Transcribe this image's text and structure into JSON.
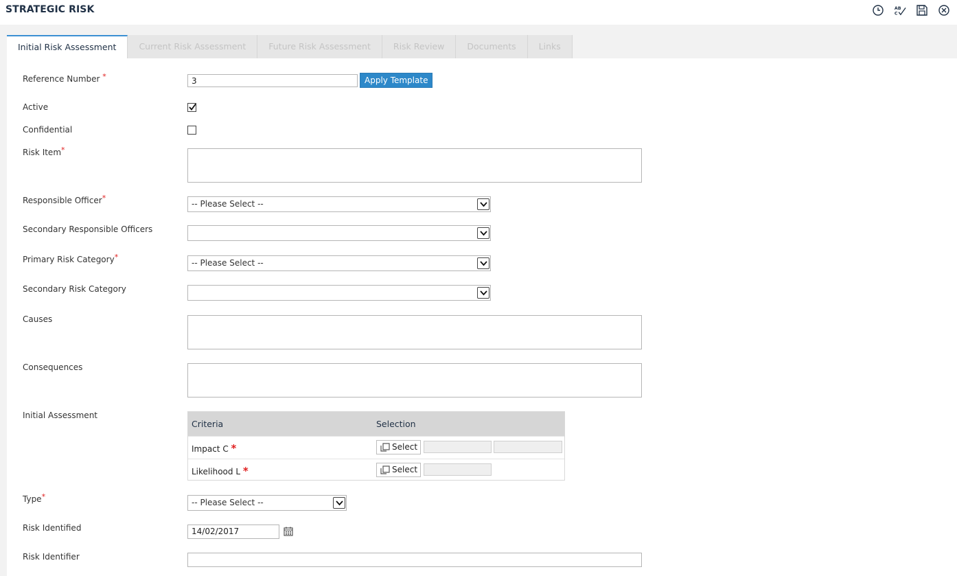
{
  "header": {
    "title": "STRATEGIC RISK",
    "toolbar": [
      {
        "name": "history-icon"
      },
      {
        "name": "spellcheck-icon"
      },
      {
        "name": "save-icon"
      },
      {
        "name": "close-icon"
      }
    ]
  },
  "tabs": [
    {
      "label": "Initial Risk Assessment",
      "active": true
    },
    {
      "label": "Current Risk Assessment",
      "active": false
    },
    {
      "label": "Future Risk Assessment",
      "active": false
    },
    {
      "label": "Risk Review",
      "active": false
    },
    {
      "label": "Documents",
      "active": false
    },
    {
      "label": "Links",
      "active": false
    }
  ],
  "form": {
    "required_marker": "*",
    "reference_number": {
      "label": "Reference Number",
      "value": "3",
      "apply_template_label": "Apply Template"
    },
    "active": {
      "label": "Active",
      "checked": true
    },
    "confidential": {
      "label": "Confidential",
      "checked": false
    },
    "risk_item": {
      "label": "Risk Item",
      "value": ""
    },
    "responsible_officer": {
      "label": "Responsible Officer",
      "value": "-- Please Select --"
    },
    "secondary_responsible_officers": {
      "label": "Secondary Responsible Officers",
      "value": ""
    },
    "primary_risk_category": {
      "label": "Primary Risk Category",
      "value": "-- Please Select --"
    },
    "secondary_risk_category": {
      "label": "Secondary Risk Category",
      "value": ""
    },
    "causes": {
      "label": "Causes",
      "value": ""
    },
    "consequences": {
      "label": "Consequences",
      "value": ""
    },
    "initial_assessment": {
      "label": "Initial Assessment",
      "columns": [
        "Criteria",
        "Selection"
      ],
      "rows": [
        {
          "criteria": "Impact C",
          "button": "Select"
        },
        {
          "criteria": "Likelihood L",
          "button": "Select"
        }
      ]
    },
    "type": {
      "label": "Type",
      "value": "-- Please Select --"
    },
    "risk_identified": {
      "label": "Risk Identified",
      "value": "14/02/2017"
    },
    "risk_identifier": {
      "label": "Risk Identifier",
      "value": ""
    }
  },
  "colors": {
    "accent": "#2d88c9",
    "required": "#e02020",
    "title": "#1f3045"
  }
}
